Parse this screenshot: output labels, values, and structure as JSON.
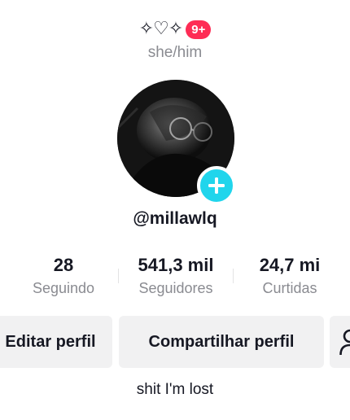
{
  "header": {
    "name_glyphs": "✧♡✧",
    "notification_badge": "9+"
  },
  "profile": {
    "pronouns": "she/him",
    "username": "@millawlq",
    "bio": "shit I'm lost"
  },
  "stats": [
    {
      "value": "28",
      "label": "Seguindo"
    },
    {
      "value": "541,3 mil",
      "label": "Seguidores"
    },
    {
      "value": "24,7 mi",
      "label": "Curtidas"
    }
  ],
  "actions": {
    "edit_label": "Editar perfil",
    "share_label": "Compartilhar perfil",
    "add_friends_icon": "add-friend-icon"
  },
  "colors": {
    "badge": "#fe2c55",
    "add_button": "#20d5ec",
    "button_bg": "#f1f1f2",
    "muted_text": "#8a8b91"
  }
}
